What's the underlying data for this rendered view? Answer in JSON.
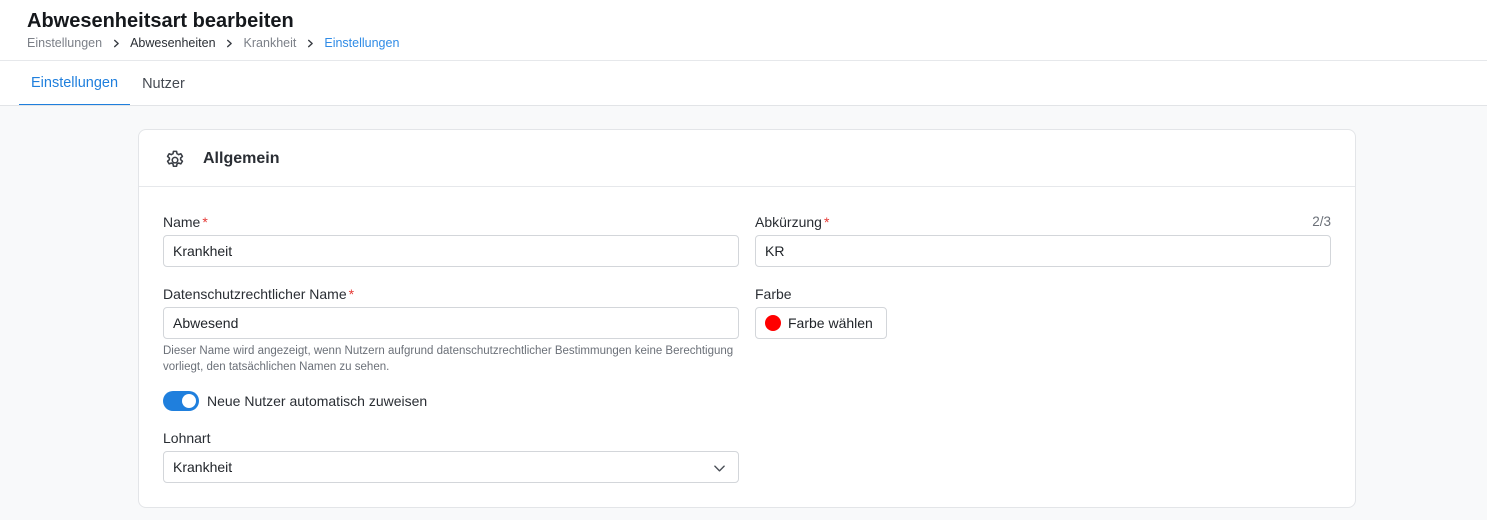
{
  "page": {
    "title": "Abwesenheitsart bearbeiten",
    "breadcrumb": [
      "Einstellungen",
      "Abwesenheiten",
      "Krankheit",
      "Einstellungen"
    ]
  },
  "tabs": [
    {
      "label": "Einstellungen",
      "active": true
    },
    {
      "label": "Nutzer",
      "active": false
    }
  ],
  "section": {
    "title": "Allgemein",
    "icon": "gear-icon"
  },
  "form": {
    "name": {
      "label": "Name",
      "value": "Krankheit"
    },
    "abbreviation": {
      "label": "Abkürzung",
      "value": "KR",
      "counter": "2/3"
    },
    "privacy_name": {
      "label": "Datenschutzrechtlicher Name",
      "value": "Abwesend",
      "hint": "Dieser Name wird angezeigt, wenn Nutzern aufgrund datenschutzrechtlicher Bestimmungen keine Berechtigung vorliegt, den tatsächlichen Namen zu sehen."
    },
    "color": {
      "label": "Farbe",
      "button_label": "Farbe wählen",
      "value": "#ff0000"
    },
    "auto_assign": {
      "label": "Neue Nutzer automatisch zuweisen",
      "enabled": true
    },
    "wage_type": {
      "label": "Lohnart",
      "value": "Krankheit"
    },
    "required_mark": "*"
  },
  "colors": {
    "accent": "#1f7fdd",
    "required": "#e53935"
  }
}
